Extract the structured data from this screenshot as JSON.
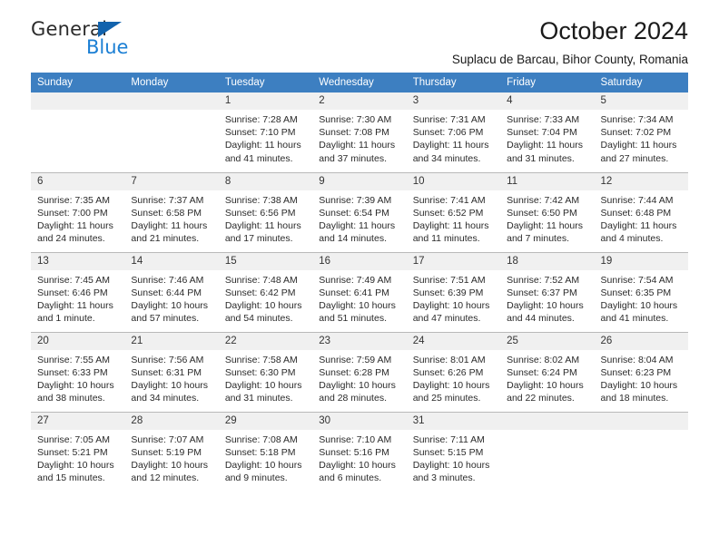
{
  "logo": {
    "word_top": "General",
    "word_bottom": "Blue",
    "triangle_color": "#1263ad",
    "blue_color": "#1b7fd4"
  },
  "header": {
    "title": "October 2024",
    "subtitle": "Suplacu de Barcau, Bihor County, Romania"
  },
  "theme": {
    "header_bg": "#3d7fc1",
    "daynum_bg": "#f0f0f0",
    "grid_line": "#b9b9b9"
  },
  "calendar": {
    "weekday_headers": [
      "Sunday",
      "Monday",
      "Tuesday",
      "Wednesday",
      "Thursday",
      "Friday",
      "Saturday"
    ],
    "weeks": [
      [
        {
          "day": "",
          "empty": true
        },
        {
          "day": "",
          "empty": true
        },
        {
          "day": "1",
          "sunrise": "Sunrise: 7:28 AM",
          "sunset": "Sunset: 7:10 PM",
          "daylight1": "Daylight: 11 hours",
          "daylight2": "and 41 minutes."
        },
        {
          "day": "2",
          "sunrise": "Sunrise: 7:30 AM",
          "sunset": "Sunset: 7:08 PM",
          "daylight1": "Daylight: 11 hours",
          "daylight2": "and 37 minutes."
        },
        {
          "day": "3",
          "sunrise": "Sunrise: 7:31 AM",
          "sunset": "Sunset: 7:06 PM",
          "daylight1": "Daylight: 11 hours",
          "daylight2": "and 34 minutes."
        },
        {
          "day": "4",
          "sunrise": "Sunrise: 7:33 AM",
          "sunset": "Sunset: 7:04 PM",
          "daylight1": "Daylight: 11 hours",
          "daylight2": "and 31 minutes."
        },
        {
          "day": "5",
          "sunrise": "Sunrise: 7:34 AM",
          "sunset": "Sunset: 7:02 PM",
          "daylight1": "Daylight: 11 hours",
          "daylight2": "and 27 minutes."
        }
      ],
      [
        {
          "day": "6",
          "sunrise": "Sunrise: 7:35 AM",
          "sunset": "Sunset: 7:00 PM",
          "daylight1": "Daylight: 11 hours",
          "daylight2": "and 24 minutes."
        },
        {
          "day": "7",
          "sunrise": "Sunrise: 7:37 AM",
          "sunset": "Sunset: 6:58 PM",
          "daylight1": "Daylight: 11 hours",
          "daylight2": "and 21 minutes."
        },
        {
          "day": "8",
          "sunrise": "Sunrise: 7:38 AM",
          "sunset": "Sunset: 6:56 PM",
          "daylight1": "Daylight: 11 hours",
          "daylight2": "and 17 minutes."
        },
        {
          "day": "9",
          "sunrise": "Sunrise: 7:39 AM",
          "sunset": "Sunset: 6:54 PM",
          "daylight1": "Daylight: 11 hours",
          "daylight2": "and 14 minutes."
        },
        {
          "day": "10",
          "sunrise": "Sunrise: 7:41 AM",
          "sunset": "Sunset: 6:52 PM",
          "daylight1": "Daylight: 11 hours",
          "daylight2": "and 11 minutes."
        },
        {
          "day": "11",
          "sunrise": "Sunrise: 7:42 AM",
          "sunset": "Sunset: 6:50 PM",
          "daylight1": "Daylight: 11 hours",
          "daylight2": "and 7 minutes."
        },
        {
          "day": "12",
          "sunrise": "Sunrise: 7:44 AM",
          "sunset": "Sunset: 6:48 PM",
          "daylight1": "Daylight: 11 hours",
          "daylight2": "and 4 minutes."
        }
      ],
      [
        {
          "day": "13",
          "sunrise": "Sunrise: 7:45 AM",
          "sunset": "Sunset: 6:46 PM",
          "daylight1": "Daylight: 11 hours",
          "daylight2": "and 1 minute."
        },
        {
          "day": "14",
          "sunrise": "Sunrise: 7:46 AM",
          "sunset": "Sunset: 6:44 PM",
          "daylight1": "Daylight: 10 hours",
          "daylight2": "and 57 minutes."
        },
        {
          "day": "15",
          "sunrise": "Sunrise: 7:48 AM",
          "sunset": "Sunset: 6:42 PM",
          "daylight1": "Daylight: 10 hours",
          "daylight2": "and 54 minutes."
        },
        {
          "day": "16",
          "sunrise": "Sunrise: 7:49 AM",
          "sunset": "Sunset: 6:41 PM",
          "daylight1": "Daylight: 10 hours",
          "daylight2": "and 51 minutes."
        },
        {
          "day": "17",
          "sunrise": "Sunrise: 7:51 AM",
          "sunset": "Sunset: 6:39 PM",
          "daylight1": "Daylight: 10 hours",
          "daylight2": "and 47 minutes."
        },
        {
          "day": "18",
          "sunrise": "Sunrise: 7:52 AM",
          "sunset": "Sunset: 6:37 PM",
          "daylight1": "Daylight: 10 hours",
          "daylight2": "and 44 minutes."
        },
        {
          "day": "19",
          "sunrise": "Sunrise: 7:54 AM",
          "sunset": "Sunset: 6:35 PM",
          "daylight1": "Daylight: 10 hours",
          "daylight2": "and 41 minutes."
        }
      ],
      [
        {
          "day": "20",
          "sunrise": "Sunrise: 7:55 AM",
          "sunset": "Sunset: 6:33 PM",
          "daylight1": "Daylight: 10 hours",
          "daylight2": "and 38 minutes."
        },
        {
          "day": "21",
          "sunrise": "Sunrise: 7:56 AM",
          "sunset": "Sunset: 6:31 PM",
          "daylight1": "Daylight: 10 hours",
          "daylight2": "and 34 minutes."
        },
        {
          "day": "22",
          "sunrise": "Sunrise: 7:58 AM",
          "sunset": "Sunset: 6:30 PM",
          "daylight1": "Daylight: 10 hours",
          "daylight2": "and 31 minutes."
        },
        {
          "day": "23",
          "sunrise": "Sunrise: 7:59 AM",
          "sunset": "Sunset: 6:28 PM",
          "daylight1": "Daylight: 10 hours",
          "daylight2": "and 28 minutes."
        },
        {
          "day": "24",
          "sunrise": "Sunrise: 8:01 AM",
          "sunset": "Sunset: 6:26 PM",
          "daylight1": "Daylight: 10 hours",
          "daylight2": "and 25 minutes."
        },
        {
          "day": "25",
          "sunrise": "Sunrise: 8:02 AM",
          "sunset": "Sunset: 6:24 PM",
          "daylight1": "Daylight: 10 hours",
          "daylight2": "and 22 minutes."
        },
        {
          "day": "26",
          "sunrise": "Sunrise: 8:04 AM",
          "sunset": "Sunset: 6:23 PM",
          "daylight1": "Daylight: 10 hours",
          "daylight2": "and 18 minutes."
        }
      ],
      [
        {
          "day": "27",
          "sunrise": "Sunrise: 7:05 AM",
          "sunset": "Sunset: 5:21 PM",
          "daylight1": "Daylight: 10 hours",
          "daylight2": "and 15 minutes."
        },
        {
          "day": "28",
          "sunrise": "Sunrise: 7:07 AM",
          "sunset": "Sunset: 5:19 PM",
          "daylight1": "Daylight: 10 hours",
          "daylight2": "and 12 minutes."
        },
        {
          "day": "29",
          "sunrise": "Sunrise: 7:08 AM",
          "sunset": "Sunset: 5:18 PM",
          "daylight1": "Daylight: 10 hours",
          "daylight2": "and 9 minutes."
        },
        {
          "day": "30",
          "sunrise": "Sunrise: 7:10 AM",
          "sunset": "Sunset: 5:16 PM",
          "daylight1": "Daylight: 10 hours",
          "daylight2": "and 6 minutes."
        },
        {
          "day": "31",
          "sunrise": "Sunrise: 7:11 AM",
          "sunset": "Sunset: 5:15 PM",
          "daylight1": "Daylight: 10 hours",
          "daylight2": "and 3 minutes."
        },
        {
          "day": "",
          "empty": true
        },
        {
          "day": "",
          "empty": true
        }
      ]
    ]
  }
}
